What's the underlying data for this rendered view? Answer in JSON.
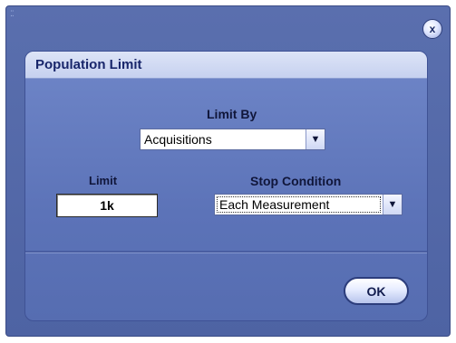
{
  "dialog": {
    "title": "Population Limit",
    "close_label": "x",
    "limit_by": {
      "label": "Limit By",
      "selected": "Acquisitions"
    },
    "limit": {
      "label": "Limit",
      "value": "1k"
    },
    "stop_condition": {
      "label": "Stop Condition",
      "selected": "Each Measurement"
    },
    "ok_label": "OK"
  },
  "icons": {
    "dropdown_arrow": "▼",
    "grip": "⁚⁚"
  },
  "colors": {
    "window_bg": "#5a6fae",
    "panel_bg": "#6f86c8",
    "header_bg": "#dde4f7",
    "title_text": "#18266b"
  }
}
